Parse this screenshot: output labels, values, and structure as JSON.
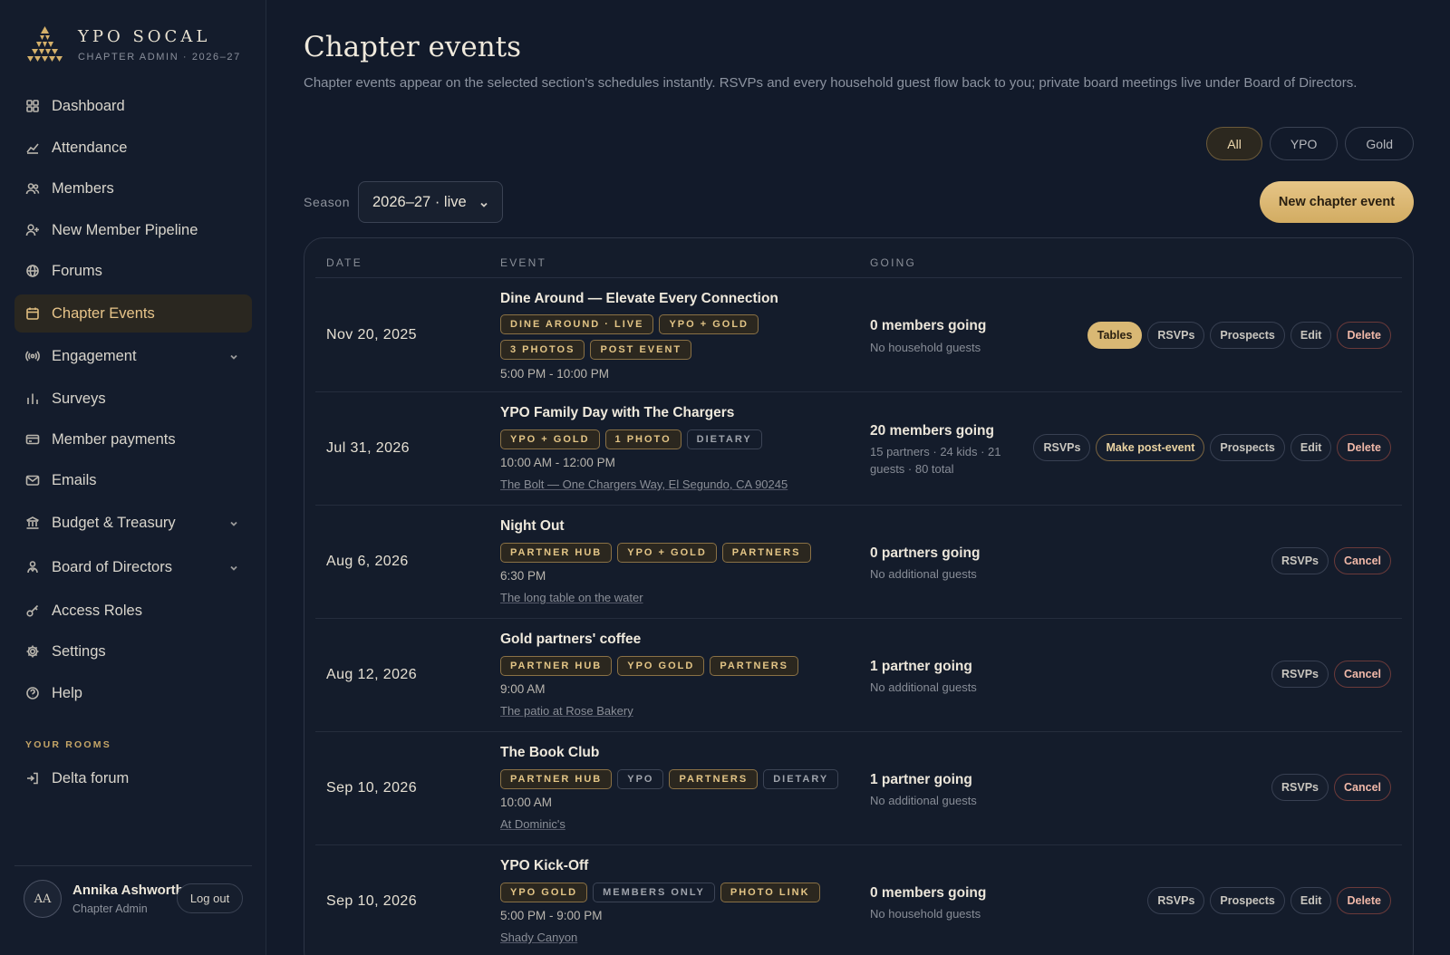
{
  "brand": {
    "name": "YPO SOCAL",
    "subtitle": "CHAPTER ADMIN · 2026–27"
  },
  "nav": [
    {
      "label": "Dashboard",
      "icon": "grid-icon"
    },
    {
      "label": "Attendance",
      "icon": "trend-icon"
    },
    {
      "label": "Members",
      "icon": "users-icon"
    },
    {
      "label": "New Member Pipeline",
      "icon": "user-plus-icon"
    },
    {
      "label": "Forums",
      "icon": "globe-icon"
    },
    {
      "label": "Chapter Events",
      "icon": "calendar-icon",
      "active": true
    },
    {
      "label": "Engagement",
      "icon": "broadcast-icon",
      "expandable": true
    },
    {
      "label": "Surveys",
      "icon": "bar-chart-icon"
    },
    {
      "label": "Member payments",
      "icon": "card-icon"
    },
    {
      "label": "Emails",
      "icon": "mail-icon"
    },
    {
      "label": "Budget & Treasury",
      "icon": "bank-icon",
      "expandable": true
    },
    {
      "label": "Board of Directors",
      "icon": "person-badge-icon",
      "expandable": true
    },
    {
      "label": "Access Roles",
      "icon": "key-icon"
    },
    {
      "label": "Settings",
      "icon": "gear-icon"
    },
    {
      "label": "Help",
      "icon": "help-icon"
    }
  ],
  "rooms": {
    "label": "YOUR ROOMS",
    "items": [
      {
        "label": "Delta forum",
        "icon": "enter-icon"
      }
    ]
  },
  "user": {
    "initials": "AA",
    "name": "Annika Ashworth",
    "role": "Chapter Admin",
    "logout_label": "Log out"
  },
  "page": {
    "title": "Chapter events",
    "description": "Chapter events appear on the selected section's schedules instantly. RSVPs and every household guest flow back to you; private board meetings live under Board of Directors."
  },
  "filters": [
    {
      "label": "All",
      "active": true
    },
    {
      "label": "YPO"
    },
    {
      "label": "Gold"
    }
  ],
  "season": {
    "label": "Season",
    "value": "2026–27 · live"
  },
  "new_event_label": "New chapter event",
  "table": {
    "headers": {
      "date": "DATE",
      "event": "EVENT",
      "going": "GOING"
    },
    "rows": [
      {
        "date": "Nov 20, 2025",
        "title": "Dine Around — Elevate Every Connection",
        "tags": [
          {
            "text": "DINE AROUND · LIVE",
            "style": "gold"
          },
          {
            "text": "YPO + GOLD",
            "style": "gold"
          },
          {
            "text": "3 PHOTOS",
            "style": "gold"
          },
          {
            "text": "POST EVENT",
            "style": "gold"
          }
        ],
        "time": "5:00 PM - 10:00 PM",
        "location": "",
        "going": "0 members going",
        "going_sub": "No household guests",
        "actions": [
          {
            "label": "Tables",
            "style": "primary"
          },
          {
            "label": "RSVPs",
            "style": "plain"
          },
          {
            "label": "Prospects",
            "style": "plain"
          },
          {
            "label": "Edit",
            "style": "plain"
          },
          {
            "label": "Delete",
            "style": "danger"
          }
        ]
      },
      {
        "date": "Jul 31, 2026",
        "title": "YPO Family Day with The Chargers",
        "tags": [
          {
            "text": "YPO + GOLD",
            "style": "gold"
          },
          {
            "text": "1 PHOTO",
            "style": "gold"
          },
          {
            "text": "DIETARY",
            "style": "plain"
          }
        ],
        "time": "10:00 AM - 12:00 PM",
        "location": "The Bolt — One Chargers Way, El Segundo, CA 90245",
        "going": "20 members going",
        "going_sub": "15 partners · 24 kids · 21 guests · 80 total",
        "actions": [
          {
            "label": "RSVPs",
            "style": "plain"
          },
          {
            "label": "Make post-event",
            "style": "goldline"
          },
          {
            "label": "Prospects",
            "style": "plain"
          },
          {
            "label": "Edit",
            "style": "plain"
          },
          {
            "label": "Delete",
            "style": "danger"
          }
        ]
      },
      {
        "date": "Aug 6, 2026",
        "title": "Night Out",
        "tags": [
          {
            "text": "PARTNER HUB",
            "style": "gold"
          },
          {
            "text": "YPO + GOLD",
            "style": "gold"
          },
          {
            "text": "PARTNERS",
            "style": "gold"
          }
        ],
        "time": "6:30 PM",
        "location": "The long table on the water",
        "going": "0 partners going",
        "going_sub": "No additional guests",
        "actions": [
          {
            "label": "RSVPs",
            "style": "plain"
          },
          {
            "label": "Cancel",
            "style": "danger"
          }
        ]
      },
      {
        "date": "Aug 12, 2026",
        "title": "Gold partners' coffee",
        "tags": [
          {
            "text": "PARTNER HUB",
            "style": "gold"
          },
          {
            "text": "YPO GOLD",
            "style": "gold"
          },
          {
            "text": "PARTNERS",
            "style": "gold"
          }
        ],
        "time": "9:00 AM",
        "location": "The patio at Rose Bakery",
        "going": "1 partner going",
        "going_sub": "No additional guests",
        "actions": [
          {
            "label": "RSVPs",
            "style": "plain"
          },
          {
            "label": "Cancel",
            "style": "danger"
          }
        ]
      },
      {
        "date": "Sep 10, 2026",
        "title": "The Book Club",
        "tags": [
          {
            "text": "PARTNER HUB",
            "style": "gold"
          },
          {
            "text": "YPO",
            "style": "plain"
          },
          {
            "text": "PARTNERS",
            "style": "gold"
          },
          {
            "text": "DIETARY",
            "style": "plain"
          }
        ],
        "time": "10:00 AM",
        "location": "At Dominic's",
        "going": "1 partner going",
        "going_sub": "No additional guests",
        "actions": [
          {
            "label": "RSVPs",
            "style": "plain"
          },
          {
            "label": "Cancel",
            "style": "danger"
          }
        ]
      },
      {
        "date": "Sep 10, 2026",
        "title": "YPO Kick-Off",
        "tags": [
          {
            "text": "YPO GOLD",
            "style": "gold"
          },
          {
            "text": "MEMBERS ONLY",
            "style": "plain"
          },
          {
            "text": "PHOTO LINK",
            "style": "gold"
          }
        ],
        "time": "5:00 PM - 9:00 PM",
        "location": "Shady Canyon",
        "going": "0 members going",
        "going_sub": "No household guests",
        "actions": [
          {
            "label": "RSVPs",
            "style": "plain"
          },
          {
            "label": "Prospects",
            "style": "plain"
          },
          {
            "label": "Edit",
            "style": "plain"
          },
          {
            "label": "Delete",
            "style": "danger"
          }
        ]
      }
    ]
  },
  "colors": {
    "accent_gold": "#d9b874",
    "background": "#121a2a",
    "danger": "#f0b8a8"
  }
}
